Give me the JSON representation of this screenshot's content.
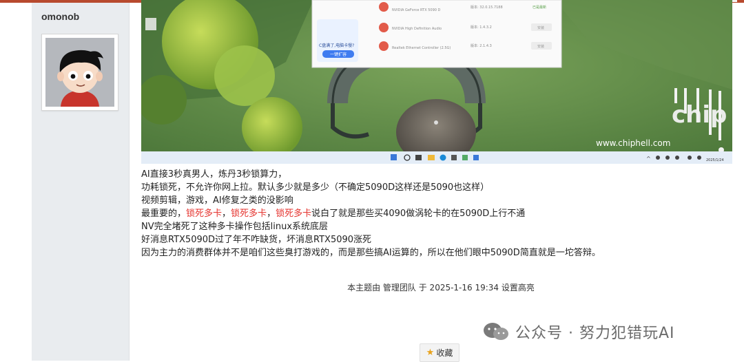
{
  "user": {
    "name": "omonob"
  },
  "image_overlay": {
    "drivers": [
      {
        "name": "NVIDIA GeForce RTX 5090 D",
        "version": "版本: 32.0.15.7188",
        "action": "已是最新"
      },
      {
        "name": "NVIDIA High Definition Audio",
        "version": "版本: 1.4.3.2",
        "action": "安装"
      },
      {
        "name": "Realtek Ethernet Controller (2.5G)",
        "version": "版本: 2.1.4.3",
        "action": "安装"
      }
    ],
    "ad_text": "C盘满了,电脑卡慢?",
    "ad_button": "一键扩容",
    "site_watermark": "www.chiphell.com",
    "logo_text": "chip hell",
    "tray_date": "2025/1/24"
  },
  "post": {
    "lines": [
      "AI直接3秒真男人，炼丹3秒锁算力，",
      "功耗锁死，不允许你网上拉。默认多少就是多少（不确定5090D这样还是5090也这样）",
      "视频剪辑，游戏，AI修复之类的没影响"
    ],
    "line4_prefix": "最重要的，",
    "line4_red": [
      "锁死多卡",
      "锁死多卡",
      "锁死多卡"
    ],
    "line4_sep": "，",
    "line4_suffix": "说白了就是那些买4090做涡轮卡的在5090D上行不通",
    "lines_after": [
      "NV完全堵死了这种多卡操作包括linux系统底层",
      "好消息RTX5090D过了年不咋缺货，坏消息RTX5090涨死",
      "因为主力的消费群体并不是咱们这些臭打游戏的，而是那些搞AI运算的，所以在他们眼中5090D简直就是一坨答辩。"
    ]
  },
  "moderation_note": "本主题由 管理团队 于 2025-1-16 19:34 设置高亮",
  "watermark": {
    "text": "公众号 · 努力犯错玩AI"
  },
  "favorite": {
    "label": "收藏"
  },
  "colors": {
    "accent_red": "#e5322d",
    "topbar": "#b84a2e",
    "sidebar_bg": "#e9ecef"
  }
}
